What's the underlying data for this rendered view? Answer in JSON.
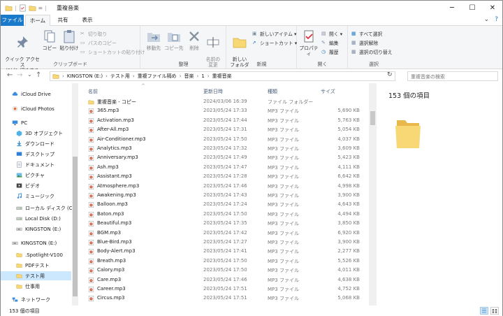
{
  "window": {
    "title": "重複音楽",
    "minimize": "─",
    "maximize": "☐",
    "close": "✕"
  },
  "quick_access": {
    "separator": "|",
    "dropdown": "="
  },
  "tabs": {
    "file": "ファイル",
    "home": "ホーム",
    "share": "共有",
    "view": "表示",
    "collapse": "⌄",
    "help": "?"
  },
  "ribbon": {
    "clipboard": {
      "label": "クリップボード",
      "pin": "クイック アクセス\nにピン留めする",
      "copy": "コピー",
      "paste": "貼り付け",
      "cut": "切り取り",
      "copy_path": "パスのコピー",
      "paste_shortcut": "ショートカットの貼り付け"
    },
    "organize": {
      "label": "整理",
      "move_to": "移動先",
      "copy_to": "コピー先",
      "delete": "削除",
      "rename": "名前の\n変更"
    },
    "new": {
      "label": "新規",
      "new_folder": "新しい\nフォルダー",
      "new_item": "新しいアイテム ▾",
      "shortcut": "ショートカット ▾"
    },
    "open": {
      "label": "開く",
      "properties": "プロパティ",
      "open": "開く ▾",
      "edit": "編集",
      "history": "履歴"
    },
    "select": {
      "label": "選択",
      "select_all": "すべて選択",
      "select_none": "選択解除",
      "invert": "選択の切り替え"
    }
  },
  "nav": {
    "back": "←",
    "forward": "→",
    "recent": "⌄",
    "up": "↑",
    "chevron": "›",
    "refresh": "↻"
  },
  "address": {
    "crumbs": [
      "KINGSTON (E:)",
      "テスト用",
      "重複ファイル隔め",
      "音楽",
      "1",
      "重複音楽"
    ]
  },
  "search": {
    "placeholder": "重複音楽の検索"
  },
  "navpane": {
    "items": [
      {
        "label": "iCloud Drive",
        "type": "cloud"
      },
      {
        "label": "iCloud Photos",
        "type": "photos"
      },
      {
        "label": "PC",
        "type": "pc"
      },
      {
        "label": "3D オブジェクト",
        "type": "3d"
      },
      {
        "label": "ダウンロード",
        "type": "download"
      },
      {
        "label": "デスクトップ",
        "type": "desktop"
      },
      {
        "label": "ドキュメント",
        "type": "docs"
      },
      {
        "label": "ピクチャ",
        "type": "pictures"
      },
      {
        "label": "ビデオ",
        "type": "video"
      },
      {
        "label": "ミュージック",
        "type": "music"
      },
      {
        "label": "ローカル ディスク (C:)",
        "type": "disk"
      },
      {
        "label": "Local Disk (D:)",
        "type": "disk"
      },
      {
        "label": "KINGSTON (E:)",
        "type": "usb"
      },
      {
        "label": "KINGSTON (E:)",
        "type": "usb"
      },
      {
        "label": ".Spotlight-V100",
        "type": "folder"
      },
      {
        "label": "PDFテスト",
        "type": "folder"
      },
      {
        "label": "テスト用",
        "type": "folder"
      },
      {
        "label": "仕事用",
        "type": "folder"
      },
      {
        "label": "ネットワーク",
        "type": "network"
      }
    ]
  },
  "columns": {
    "name": "名前",
    "date": "更新日時",
    "type": "種類",
    "size": "サイズ",
    "sort": "^"
  },
  "files": [
    {
      "name": "重複音楽 - コピー",
      "date": "2024/03/06 16:39",
      "type": "ファイル フォルダー",
      "size": "",
      "icon": "folder"
    },
    {
      "name": "365.mp3",
      "date": "2023/05/24 17:33",
      "type": "MP3 ファイル",
      "size": "5,690 KB",
      "icon": "mp3"
    },
    {
      "name": "Activation.mp3",
      "date": "2023/05/24 17:44",
      "type": "MP3 ファイル",
      "size": "5,763 KB",
      "icon": "mp3"
    },
    {
      "name": "After-All.mp3",
      "date": "2023/05/24 17:31",
      "type": "MP3 ファイル",
      "size": "5,054 KB",
      "icon": "mp3"
    },
    {
      "name": "Air-Conditioner.mp3",
      "date": "2023/05/24 17:50",
      "type": "MP3 ファイル",
      "size": "4,037 KB",
      "icon": "mp3"
    },
    {
      "name": "Analytics.mp3",
      "date": "2023/05/24 17:32",
      "type": "MP3 ファイル",
      "size": "3,609 KB",
      "icon": "mp3"
    },
    {
      "name": "Anniversary.mp3",
      "date": "2023/05/24 17:49",
      "type": "MP3 ファイル",
      "size": "5,423 KB",
      "icon": "mp3"
    },
    {
      "name": "Ash.mp3",
      "date": "2023/05/24 17:47",
      "type": "MP3 ファイル",
      "size": "4,111 KB",
      "icon": "mp3"
    },
    {
      "name": "Assistant.mp3",
      "date": "2023/05/24 17:28",
      "type": "MP3 ファイル",
      "size": "6,642 KB",
      "icon": "mp3"
    },
    {
      "name": "Atmosphere.mp3",
      "date": "2023/05/24 17:46",
      "type": "MP3 ファイル",
      "size": "4,998 KB",
      "icon": "mp3"
    },
    {
      "name": "Awakening.mp3",
      "date": "2023/05/24 17:43",
      "type": "MP3 ファイル",
      "size": "3,900 KB",
      "icon": "mp3"
    },
    {
      "name": "Balloon.mp3",
      "date": "2023/05/24 17:24",
      "type": "MP3 ファイル",
      "size": "4,643 KB",
      "icon": "mp3"
    },
    {
      "name": "Baton.mp3",
      "date": "2023/05/24 17:50",
      "type": "MP3 ファイル",
      "size": "4,494 KB",
      "icon": "mp3"
    },
    {
      "name": "Beautiful.mp3",
      "date": "2023/05/24 17:35",
      "type": "MP3 ファイル",
      "size": "3,850 KB",
      "icon": "mp3"
    },
    {
      "name": "BGM.mp3",
      "date": "2023/05/24 17:42",
      "type": "MP3 ファイル",
      "size": "6,920 KB",
      "icon": "mp3"
    },
    {
      "name": "Blue-Bird.mp3",
      "date": "2023/05/24 17:27",
      "type": "MP3 ファイル",
      "size": "3,900 KB",
      "icon": "mp3"
    },
    {
      "name": "Body-Alert.mp3",
      "date": "2023/05/24 17:41",
      "type": "MP3 ファイル",
      "size": "2,277 KB",
      "icon": "mp3"
    },
    {
      "name": "Breath.mp3",
      "date": "2023/05/24 17:50",
      "type": "MP3 ファイル",
      "size": "5,526 KB",
      "icon": "mp3"
    },
    {
      "name": "Calory.mp3",
      "date": "2023/05/24 17:50",
      "type": "MP3 ファイル",
      "size": "4,011 KB",
      "icon": "mp3"
    },
    {
      "name": "Care.mp3",
      "date": "2023/05/24 17:46",
      "type": "MP3 ファイル",
      "size": "4,638 KB",
      "icon": "mp3"
    },
    {
      "name": "Career.mp3",
      "date": "2023/05/24 17:51",
      "type": "MP3 ファイル",
      "size": "4,752 KB",
      "icon": "mp3"
    },
    {
      "name": "Circus.mp3",
      "date": "2023/05/24 17:51",
      "type": "MP3 ファイル",
      "size": "5,068 KB",
      "icon": "mp3"
    }
  ],
  "preview": {
    "count": "153 個の項目"
  },
  "status": {
    "text": "153 個の項目"
  },
  "colors": {
    "accent": "#1979ca",
    "folder": "#f8d775",
    "folder_dark": "#e8b84a",
    "selected": "#cce8ff"
  }
}
